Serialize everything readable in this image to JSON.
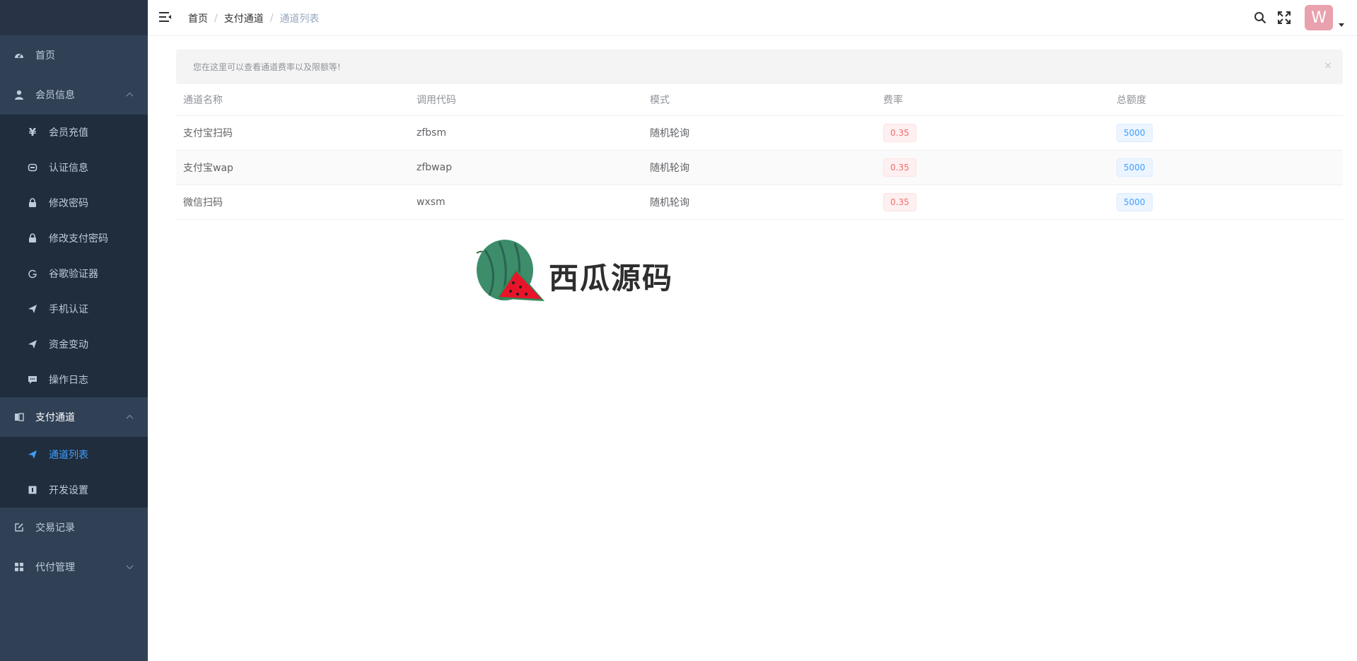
{
  "sidebar": {
    "items": [
      {
        "label": "首页",
        "icon": "dashboard-icon"
      },
      {
        "label": "会员信息",
        "icon": "user-icon",
        "expanded": true
      },
      {
        "label": "支付通道",
        "icon": "book-icon",
        "expanded": true
      },
      {
        "label": "交易记录",
        "icon": "edit-icon"
      },
      {
        "label": "代付管理",
        "icon": "grid-icon",
        "expanded": false
      }
    ],
    "member_sub": [
      {
        "label": "会员充值",
        "icon": "yen-icon"
      },
      {
        "label": "认证信息",
        "icon": "id-card-icon"
      },
      {
        "label": "修改密码",
        "icon": "lock-icon"
      },
      {
        "label": "修改支付密码",
        "icon": "lock-icon"
      },
      {
        "label": "谷歌验证器",
        "icon": "google-icon"
      },
      {
        "label": "手机认证",
        "icon": "send-icon"
      },
      {
        "label": "资金变动",
        "icon": "send-icon"
      },
      {
        "label": "操作日志",
        "icon": "message-icon"
      }
    ],
    "channel_sub": [
      {
        "label": "通道列表",
        "icon": "send-icon",
        "active": true
      },
      {
        "label": "开发设置",
        "icon": "info-icon"
      }
    ]
  },
  "breadcrumb": {
    "home": "首页",
    "section": "支付通道",
    "current": "通道列表"
  },
  "user": {
    "avatar_letter": "W"
  },
  "alert": {
    "text": "您在这里可以查看通道费率以及限额等!",
    "close": "×"
  },
  "table": {
    "headers": [
      "通道名称",
      "调用代码",
      "模式",
      "费率",
      "总额度"
    ],
    "rows": [
      {
        "name": "支付宝扫码",
        "code": "zfbsm",
        "mode": "随机轮询",
        "rate": "0.35",
        "limit": "5000"
      },
      {
        "name": "支付宝wap",
        "code": "zfbwap",
        "mode": "随机轮询",
        "rate": "0.35",
        "limit": "5000"
      },
      {
        "name": "微信扫码",
        "code": "wxsm",
        "mode": "随机轮询",
        "rate": "0.35",
        "limit": "5000"
      }
    ]
  },
  "watermark": {
    "text": "西瓜源码"
  },
  "colors": {
    "sidebar_bg": "#304156",
    "submenu_bg": "#1f2d3d",
    "active": "#409eff",
    "rate_tag": "#f56c6c",
    "limit_tag": "#409eff",
    "avatar_bg": "#e8a1ad"
  }
}
